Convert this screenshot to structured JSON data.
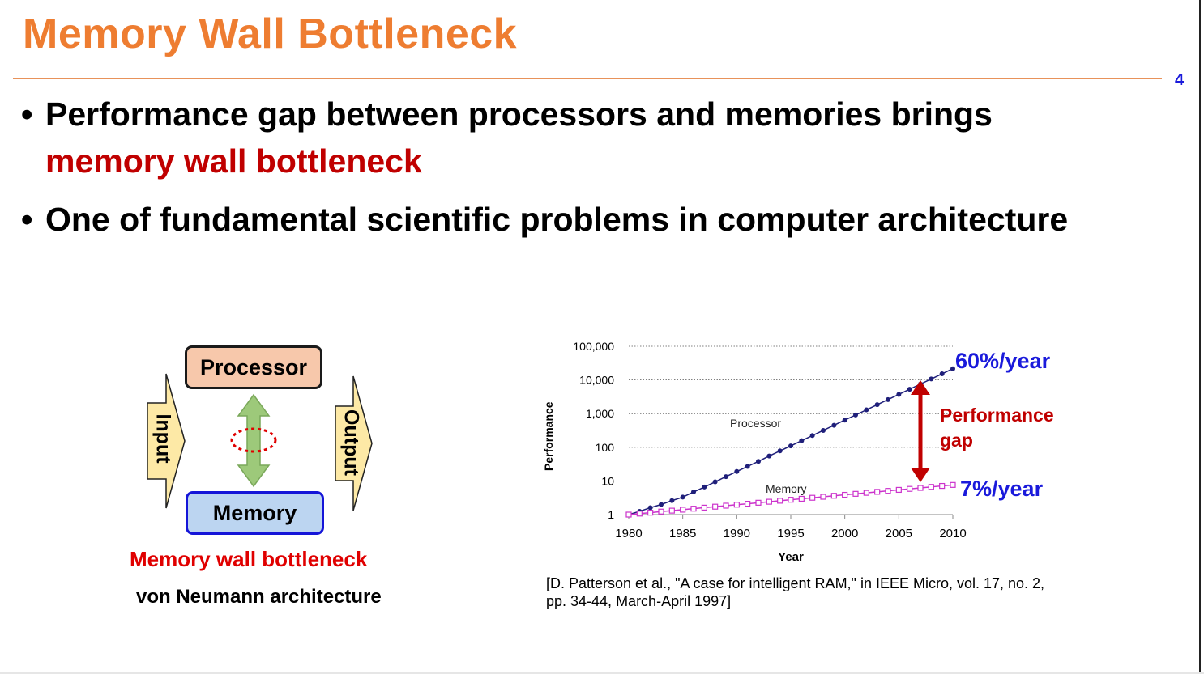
{
  "slide": {
    "title": "Memory Wall Bottleneck",
    "page_number": "4",
    "bullet1_line1": "Performance gap between processors and memories brings",
    "bullet1_line2": "memory wall bottleneck",
    "bullet2": "One of fundamental scientific problems in computer architecture",
    "bullet_glyph": "•"
  },
  "diagram": {
    "processor_label": "Processor",
    "memory_label": "Memory",
    "input_label": "Input",
    "output_label": "Output",
    "caption_red": "Memory wall bottleneck",
    "caption_black": "von Neumann architecture",
    "colors": {
      "processor_fill": "#f7c8ab",
      "memory_fill": "#bcd5f1",
      "memory_border": "#1515d8",
      "arrow_green": "#9dc97a",
      "io_arrow": "#fde9a6",
      "bottleneck_ring": "#e00000"
    }
  },
  "annotations": {
    "processor_rate": "60%/year",
    "memory_rate": "7%/year",
    "gap_line1": "Performance",
    "gap_line2": "gap"
  },
  "citation": {
    "line1": "[D. Patterson et al., \"A case for intelligent RAM,\" in IEEE Micro, vol. 17, no. 2,",
    "line2": "pp. 34-44, March-April 1997]"
  },
  "chart_data": {
    "type": "line",
    "title": "",
    "xlabel": "Year",
    "ylabel": "Performance",
    "y_scale": "log",
    "ylim": [
      1,
      100000
    ],
    "xlim": [
      1980,
      2010
    ],
    "x_ticks": [
      "1980",
      "1985",
      "1990",
      "1995",
      "2000",
      "2005",
      "2010"
    ],
    "y_ticks": [
      "1",
      "10",
      "100",
      "1,000",
      "10,000",
      "100,000"
    ],
    "y_tick_values": [
      1,
      10,
      100,
      1000,
      10000,
      100000
    ],
    "grid": "horizontal dotted",
    "x": [
      1980,
      1981,
      1982,
      1983,
      1984,
      1985,
      1986,
      1987,
      1988,
      1989,
      1990,
      1991,
      1992,
      1993,
      1994,
      1995,
      1996,
      1997,
      1998,
      1999,
      2000,
      2001,
      2002,
      2003,
      2004,
      2005,
      2006,
      2007,
      2008,
      2009,
      2010
    ],
    "series": [
      {
        "name": "Processor",
        "color": "#1f1f7a",
        "marker": "filled-circle",
        "values": [
          1,
          1.25,
          1.6,
          2.0,
          2.6,
          3.3,
          4.7,
          6.6,
          9.4,
          13.4,
          19,
          27,
          38,
          55,
          78,
          110,
          157,
          223,
          317,
          451,
          641,
          911,
          1295,
          1841,
          2617,
          3720,
          5288,
          7517,
          10685,
          15190,
          21590
        ]
      },
      {
        "name": "Memory",
        "color": "#cc33cc",
        "marker": "hollow-square",
        "values": [
          1,
          1.07,
          1.14,
          1.23,
          1.31,
          1.4,
          1.5,
          1.61,
          1.72,
          1.84,
          1.97,
          2.1,
          2.25,
          2.41,
          2.58,
          2.76,
          2.95,
          3.16,
          3.38,
          3.62,
          3.87,
          4.14,
          4.43,
          4.74,
          5.07,
          5.43,
          5.81,
          6.21,
          6.65,
          7.11,
          7.61
        ]
      }
    ],
    "series_labels_on_chart": [
      "Processor",
      "Memory"
    ]
  }
}
